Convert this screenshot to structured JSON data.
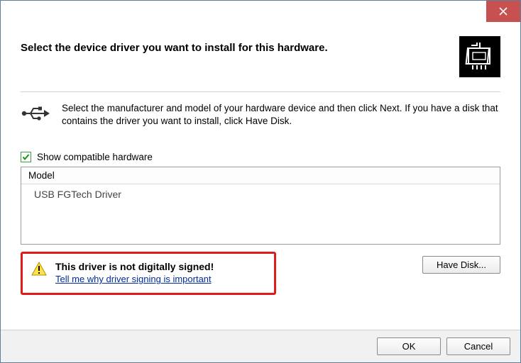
{
  "title": "Select the device driver you want to install for this hardware.",
  "instruction": "Select the manufacturer and model of your hardware device and then click Next. If you have a disk that contains the driver you want to install, click Have Disk.",
  "show_compatible_label": "Show compatible hardware",
  "list": {
    "header": "Model",
    "items": [
      "USB FGTech Driver"
    ]
  },
  "warning": {
    "title": "This driver is not digitally signed!",
    "link": "Tell me why driver signing is important"
  },
  "buttons": {
    "have_disk": "Have Disk...",
    "ok": "OK",
    "cancel": "Cancel"
  }
}
